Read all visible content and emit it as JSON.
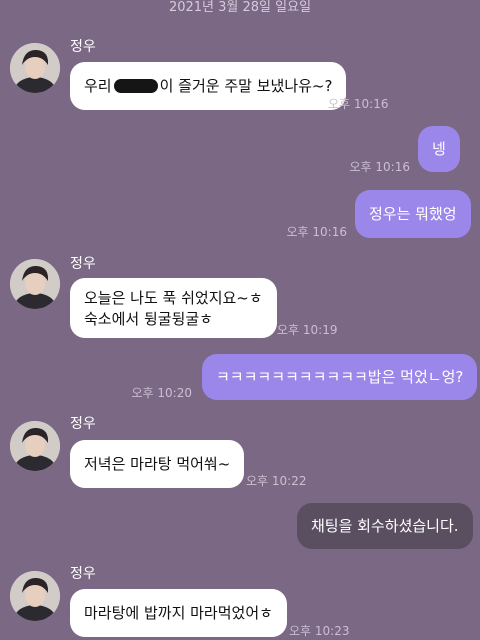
{
  "date_header": "2021년 3월 28일 일요일",
  "contact": {
    "name": "정우"
  },
  "messages": [
    {
      "sender": "정우",
      "direction": "in",
      "text_before": "우리",
      "text_after": "이 즐거운 주말 보냈나유~?",
      "time": "오후 10:16"
    },
    {
      "direction": "out",
      "text": "넹",
      "time": "오후 10:16"
    },
    {
      "direction": "out",
      "text": "정우는 뭐했엉",
      "time": "오후 10:16"
    },
    {
      "sender": "정우",
      "direction": "in",
      "lines": [
        "오늘은 나도 푹 쉬었지요~ㅎ",
        "숙소에서 뒹굴뒹굴ㅎ"
      ],
      "time": "오후 10:19"
    },
    {
      "direction": "out",
      "text": "ㅋㅋㅋㅋㅋㅋㅋㅋㅋㅋㅋ밥은 먹었ㄴ엉?",
      "time": "오후 10:20"
    },
    {
      "sender": "정우",
      "direction": "in",
      "text": "저녁은 마라탕 먹어쒀~",
      "time": "오후 10:22"
    },
    {
      "direction": "out",
      "recalled": true,
      "text": "채팅을 회수하셨습니다."
    },
    {
      "sender": "정우",
      "direction": "in",
      "text": "마라탕에 밥까지 마라먹었어ㅎ",
      "time": "오후 10:23"
    }
  ],
  "colors": {
    "background": "#7b6884",
    "incoming_bubble": "#ffffff",
    "outgoing_bubble": "#9b87ea",
    "recalled_bubble": "#5a4f61"
  },
  "icons": {
    "avatar": "profile-photo",
    "redaction": "redacted-name-mark"
  }
}
